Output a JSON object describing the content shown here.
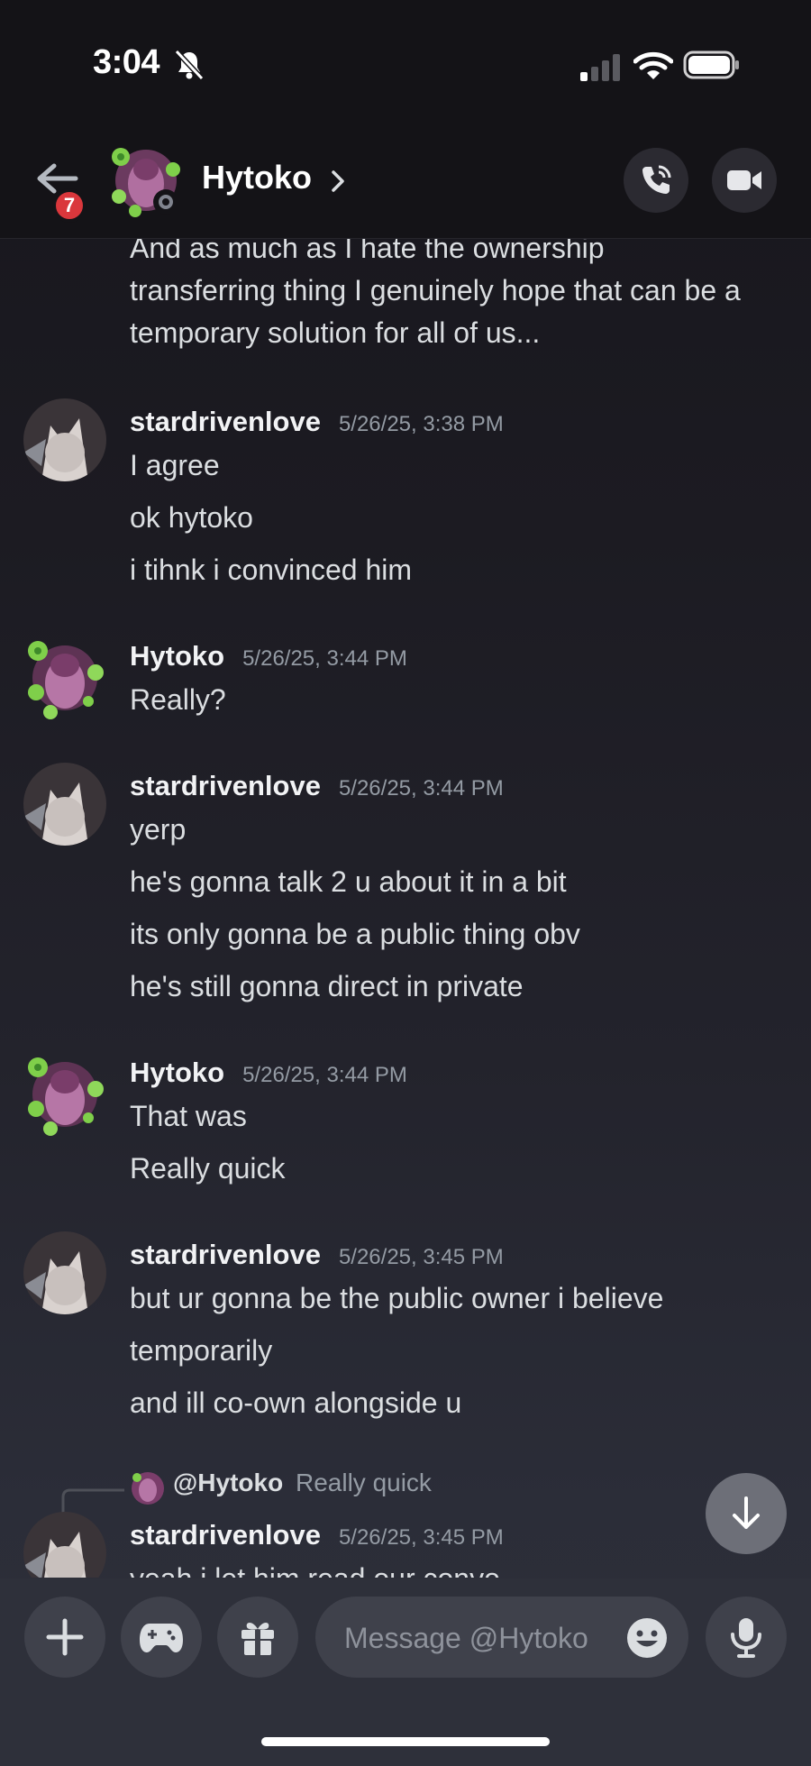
{
  "status_bar": {
    "time": "3:04"
  },
  "header": {
    "name": "Hytoko",
    "unread_badge": "7"
  },
  "messages": {
    "continued": [
      "And as much as I hate the ownership",
      "transferring thing I genuinely hope that can be a",
      "temporary solution for all of us..."
    ],
    "groups": [
      {
        "author": "stardrivenlove",
        "time": "5/26/25, 3:38 PM",
        "lines": [
          "I agree",
          "ok hytoko",
          "i tihnk i convinced him"
        ]
      },
      {
        "author": "Hytoko",
        "time": "5/26/25, 3:44 PM",
        "lines": [
          "Really?"
        ]
      },
      {
        "author": "stardrivenlove",
        "time": "5/26/25, 3:44 PM",
        "lines": [
          "yerp",
          "he's gonna talk 2 u about it in a bit",
          "its only gonna be a public thing obv",
          "he's still gonna direct in private"
        ]
      },
      {
        "author": "Hytoko",
        "time": "5/26/25, 3:44 PM",
        "lines": [
          "That was",
          "Really quick"
        ]
      },
      {
        "author": "stardrivenlove",
        "time": "5/26/25, 3:45 PM",
        "lines": [
          "but ur gonna be the public owner i believe",
          "temporarily",
          "and ill co-own alongside u"
        ]
      },
      {
        "author": "stardrivenlove",
        "time": "5/26/25, 3:45 PM",
        "lines": [
          "yeah i let him read our convo"
        ]
      }
    ],
    "reply": {
      "mention": "@Hytoko",
      "quoted": "Really quick"
    }
  },
  "composer": {
    "placeholder": "Message @Hytoko"
  },
  "colors": {
    "background": "#1c1b22",
    "badge": "#da373c",
    "text": "#dbdee1",
    "muted": "#949ba4"
  },
  "icons": [
    "bell-slash-icon",
    "signal-icon",
    "wifi-icon",
    "battery-icon",
    "back-arrow-icon",
    "chevron-right-icon",
    "phone-call-icon",
    "video-icon",
    "arrow-down-icon",
    "plus-icon",
    "gamepad-icon",
    "gift-icon",
    "emoji-icon",
    "microphone-icon"
  ]
}
